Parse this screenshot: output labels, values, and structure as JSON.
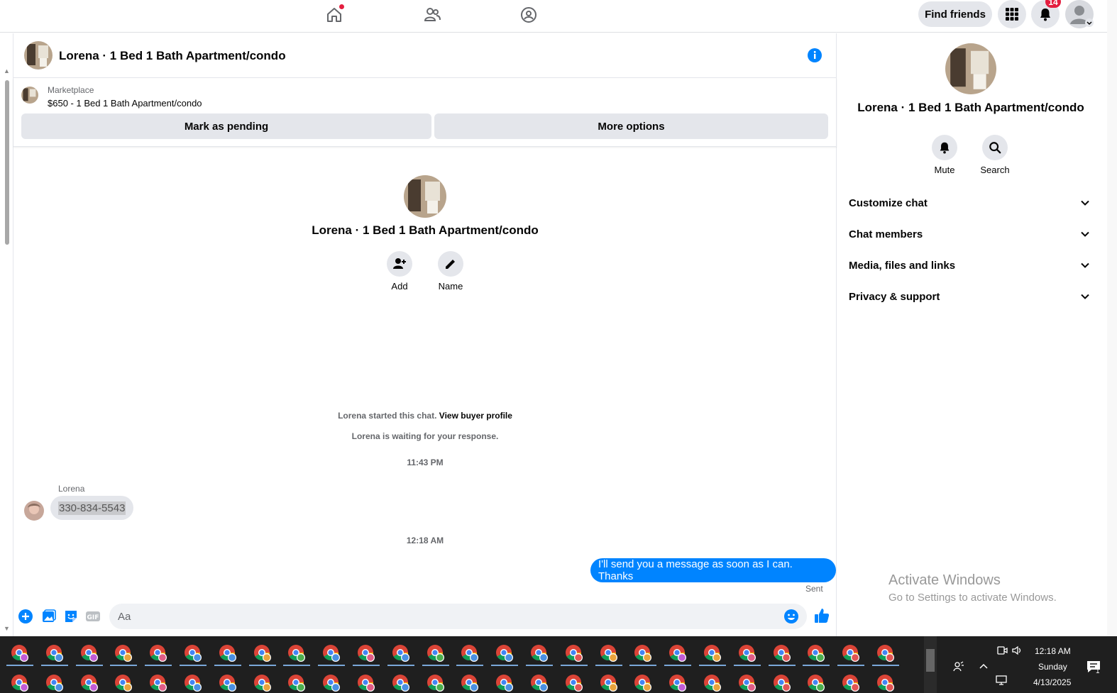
{
  "topnav": {
    "find_friends_label": "Find friends",
    "notification_count": "14",
    "icons": [
      "home-icon",
      "friends-icon",
      "groups-icon",
      "menu-grid-icon",
      "bell-icon",
      "avatar"
    ]
  },
  "chat": {
    "title": "Lorena · 1 Bed 1 Bath Apartment/condo",
    "marketplace_label": "Marketplace",
    "listing": "$650 - 1 Bed 1 Bath Apartment/condo",
    "mark_pending_label": "Mark as pending",
    "more_options_label": "More options",
    "profile_name": "Lorena · 1 Bed 1 Bath Apartment/condo",
    "add_label": "Add",
    "name_label": "Name",
    "started_text": "Lorena started this chat.",
    "view_buyer_label": "View buyer profile",
    "waiting_text": "Lorena is waiting for your response.",
    "time1": "11:43 PM",
    "sender": "Lorena",
    "incoming_message": "330-834-5543",
    "time2": "12:18 AM",
    "outgoing_message": "I'll send you a message as soon as I can. Thanks",
    "sent_label": "Sent",
    "composer_placeholder": "Aa"
  },
  "right_panel": {
    "name": "Lorena · 1 Bed 1 Bath Apartment/condo",
    "mute_label": "Mute",
    "search_label": "Search",
    "sections": [
      "Customize chat",
      "Chat members",
      "Media, files and links",
      "Privacy & support"
    ],
    "watermark_title": "Activate Windows",
    "watermark_sub": "Go to Settings to activate Windows."
  },
  "taskbar": {
    "time": "12:18 AM",
    "day": "Sunday",
    "date": "4/13/2025",
    "notification_count": "1"
  },
  "colors": {
    "accent": "#0084ff",
    "badge": "#e41e3f",
    "button_gray": "#e4e6eb"
  }
}
